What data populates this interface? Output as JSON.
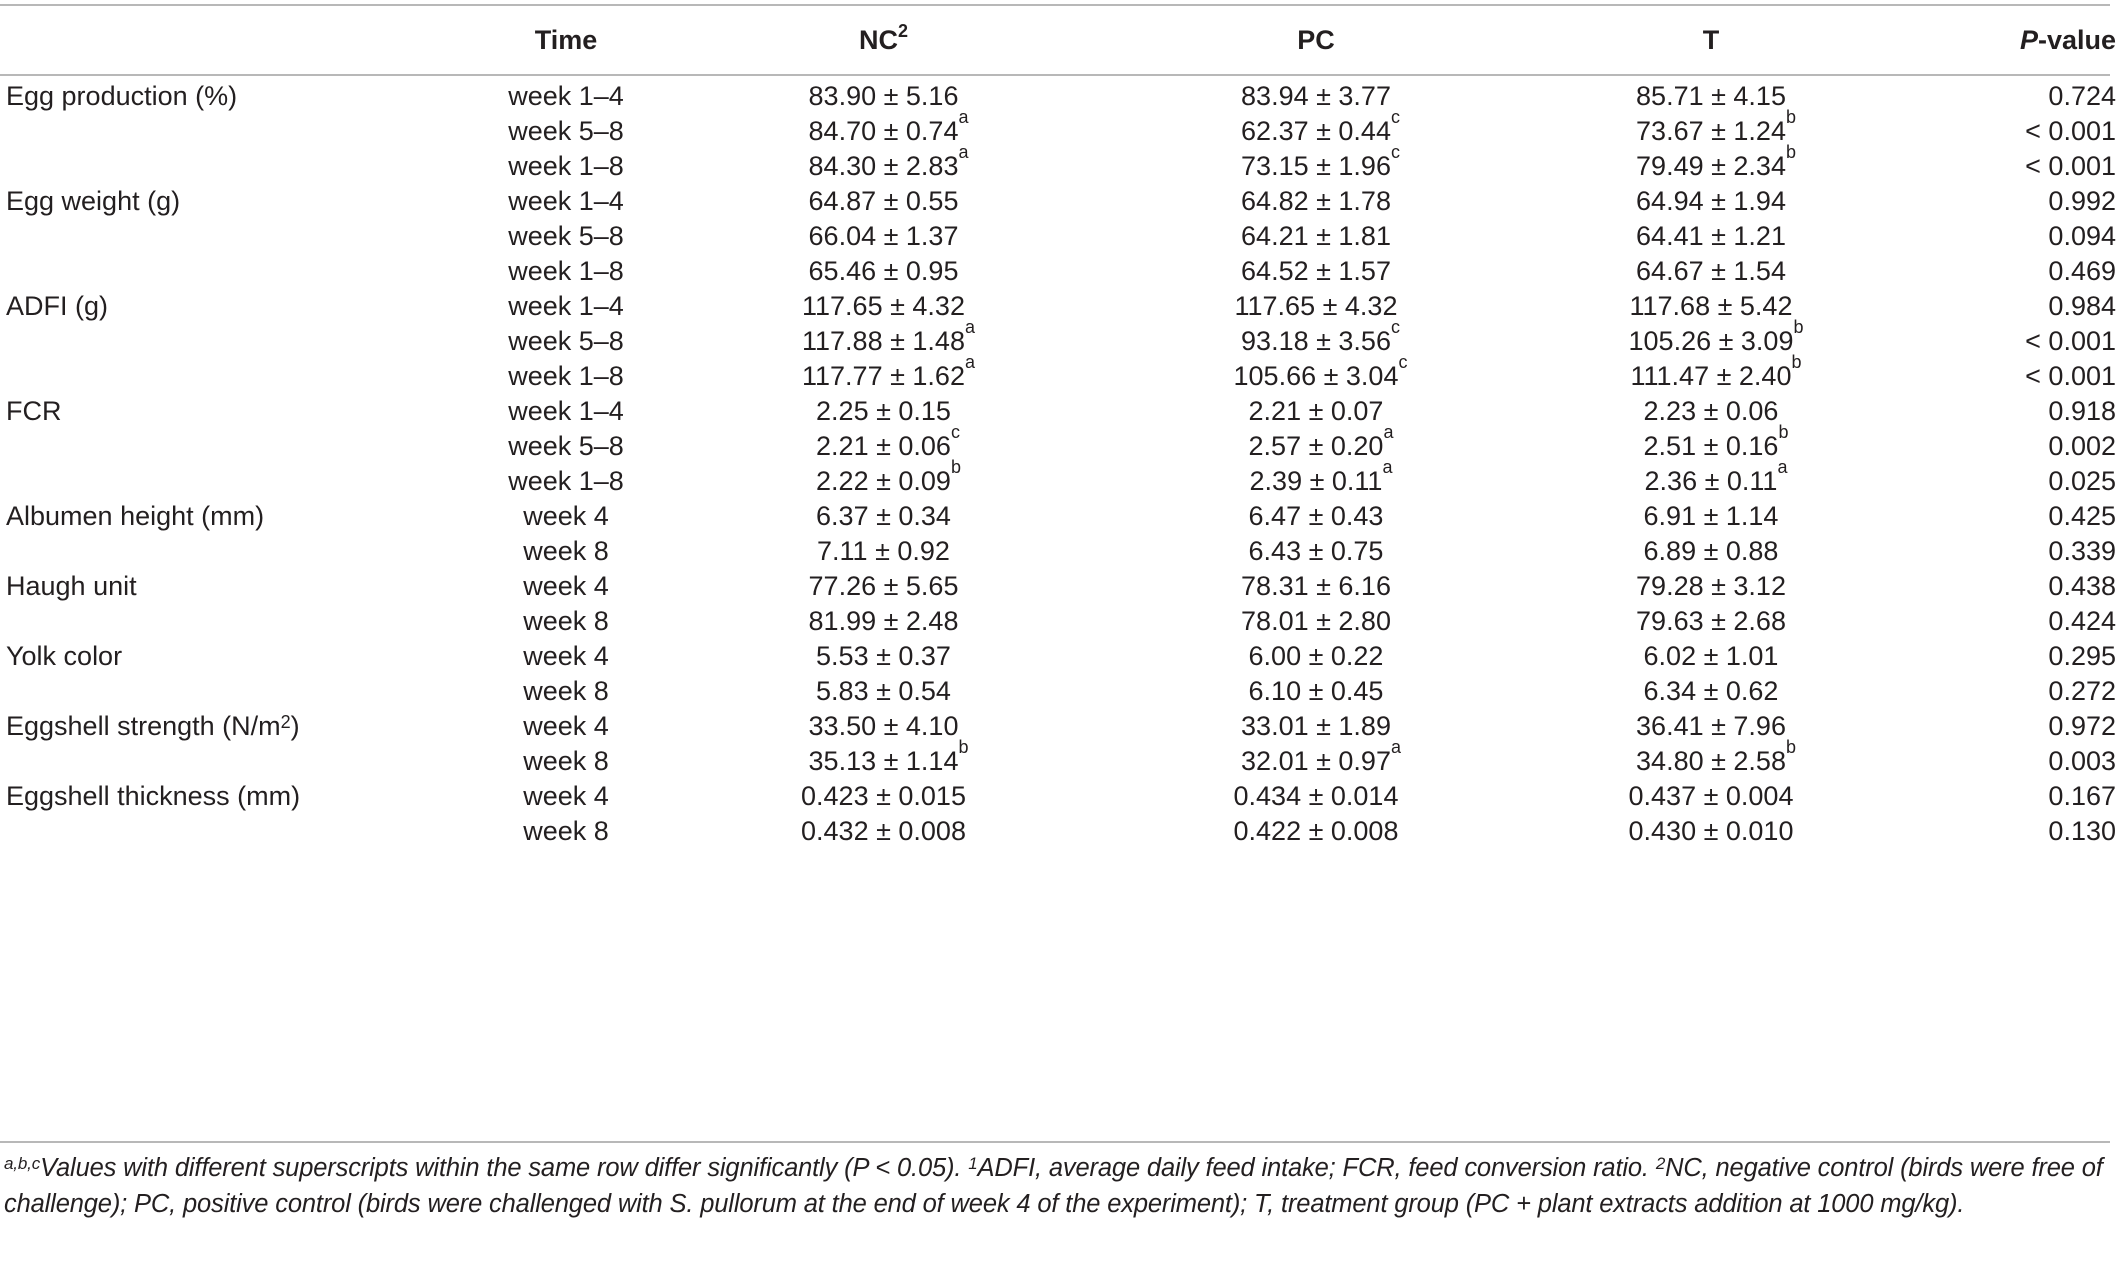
{
  "table": {
    "headers": {
      "parameter": "",
      "time": "Time",
      "nc": "NC",
      "nc_sup": "2",
      "pc": "PC",
      "t": "T",
      "p_italic": "P",
      "p_rest": "-value"
    },
    "rows": [
      {
        "param": "Egg production (%)",
        "param_sup": "",
        "param_tail": "",
        "time": "week 1–4",
        "nc": "83.90 ± 5.16",
        "nc_sup": "",
        "pc": "83.94 ± 3.77",
        "pc_sup": "",
        "t": "85.71 ± 4.15",
        "t_sup": "",
        "p": "0.724"
      },
      {
        "param": "",
        "param_sup": "",
        "param_tail": "",
        "time": "week 5–8",
        "nc": "84.70 ± 0.74",
        "nc_sup": "a",
        "pc": "62.37 ± 0.44",
        "pc_sup": "c",
        "t": "73.67 ± 1.24",
        "t_sup": "b",
        "p": "< 0.001"
      },
      {
        "param": "",
        "param_sup": "",
        "param_tail": "",
        "time": "week 1–8",
        "nc": "84.30 ± 2.83",
        "nc_sup": "a",
        "pc": "73.15 ± 1.96",
        "pc_sup": "c",
        "t": "79.49 ± 2.34",
        "t_sup": "b",
        "p": "< 0.001"
      },
      {
        "param": "Egg weight (g)",
        "param_sup": "",
        "param_tail": "",
        "time": "week 1–4",
        "nc": "64.87 ± 0.55",
        "nc_sup": "",
        "pc": "64.82 ± 1.78",
        "pc_sup": "",
        "t": "64.94 ± 1.94",
        "t_sup": "",
        "p": "0.992"
      },
      {
        "param": "",
        "param_sup": "",
        "param_tail": "",
        "time": "week 5–8",
        "nc": "66.04 ± 1.37",
        "nc_sup": "",
        "pc": "64.21 ± 1.81",
        "pc_sup": "",
        "t": "64.41 ± 1.21",
        "t_sup": "",
        "p": "0.094"
      },
      {
        "param": "",
        "param_sup": "",
        "param_tail": "",
        "time": "week 1–8",
        "nc": "65.46 ± 0.95",
        "nc_sup": "",
        "pc": "64.52 ± 1.57",
        "pc_sup": "",
        "t": "64.67 ± 1.54",
        "t_sup": "",
        "p": "0.469"
      },
      {
        "param": "ADFI (g)",
        "param_sup": "",
        "param_tail": "",
        "time": "week 1–4",
        "nc": "117.65 ± 4.32",
        "nc_sup": "",
        "pc": "117.65 ± 4.32",
        "pc_sup": "",
        "t": "117.68 ± 5.42",
        "t_sup": "",
        "p": "0.984"
      },
      {
        "param": "",
        "param_sup": "",
        "param_tail": "",
        "time": "week 5–8",
        "nc": "117.88 ± 1.48",
        "nc_sup": "a",
        "pc": "93.18 ± 3.56",
        "pc_sup": "c",
        "t": "105.26 ± 3.09",
        "t_sup": "b",
        "p": "< 0.001"
      },
      {
        "param": "",
        "param_sup": "",
        "param_tail": "",
        "time": "week 1–8",
        "nc": "117.77 ± 1.62",
        "nc_sup": "a",
        "pc": "105.66 ± 3.04",
        "pc_sup": "c",
        "t": "111.47 ± 2.40",
        "t_sup": "b",
        "p": "< 0.001"
      },
      {
        "param": "FCR",
        "param_sup": "",
        "param_tail": "",
        "time": "week 1–4",
        "nc": "2.25 ± 0.15",
        "nc_sup": "",
        "pc": "2.21 ± 0.07",
        "pc_sup": "",
        "t": "2.23 ± 0.06",
        "t_sup": "",
        "p": "0.918"
      },
      {
        "param": "",
        "param_sup": "",
        "param_tail": "",
        "time": "week 5–8",
        "nc": "2.21 ± 0.06",
        "nc_sup": "c",
        "pc": "2.57 ± 0.20",
        "pc_sup": "a",
        "t": "2.51 ± 0.16",
        "t_sup": "b",
        "p": "0.002"
      },
      {
        "param": "",
        "param_sup": "",
        "param_tail": "",
        "time": "week 1–8",
        "nc": "2.22 ± 0.09",
        "nc_sup": "b",
        "pc": "2.39 ± 0.11",
        "pc_sup": "a",
        "t": "2.36 ± 0.11",
        "t_sup": "a",
        "p": "0.025"
      },
      {
        "param": "Albumen height (mm)",
        "param_sup": "",
        "param_tail": "",
        "time": "week 4",
        "nc": "6.37 ± 0.34",
        "nc_sup": "",
        "pc": "6.47 ± 0.43",
        "pc_sup": "",
        "t": "6.91 ± 1.14",
        "t_sup": "",
        "p": "0.425"
      },
      {
        "param": "",
        "param_sup": "",
        "param_tail": "",
        "time": "week 8",
        "nc": "7.11 ± 0.92",
        "nc_sup": "",
        "pc": "6.43 ± 0.75",
        "pc_sup": "",
        "t": "6.89 ± 0.88",
        "t_sup": "",
        "p": "0.339"
      },
      {
        "param": "Haugh unit",
        "param_sup": "",
        "param_tail": "",
        "time": "week 4",
        "nc": "77.26 ± 5.65",
        "nc_sup": "",
        "pc": "78.31 ± 6.16",
        "pc_sup": "",
        "t": "79.28 ± 3.12",
        "t_sup": "",
        "p": "0.438"
      },
      {
        "param": "",
        "param_sup": "",
        "param_tail": "",
        "time": "week 8",
        "nc": "81.99 ± 2.48",
        "nc_sup": "",
        "pc": "78.01 ± 2.80",
        "pc_sup": "",
        "t": "79.63 ± 2.68",
        "t_sup": "",
        "p": "0.424"
      },
      {
        "param": "Yolk color",
        "param_sup": "",
        "param_tail": "",
        "time": "week 4",
        "nc": "5.53 ± 0.37",
        "nc_sup": "",
        "pc": "6.00 ± 0.22",
        "pc_sup": "",
        "t": "6.02 ± 1.01",
        "t_sup": "",
        "p": "0.295"
      },
      {
        "param": "",
        "param_sup": "",
        "param_tail": "",
        "time": "week 8",
        "nc": "5.83 ± 0.54",
        "nc_sup": "",
        "pc": "6.10 ± 0.45",
        "pc_sup": "",
        "t": "6.34 ± 0.62",
        "t_sup": "",
        "p": "0.272"
      },
      {
        "param": "Eggshell strength (N/m",
        "param_sup": "2",
        "param_tail": ")",
        "time": "week 4",
        "nc": "33.50 ± 4.10",
        "nc_sup": "",
        "pc": "33.01 ± 1.89",
        "pc_sup": "",
        "t": "36.41 ± 7.96",
        "t_sup": "",
        "p": "0.972"
      },
      {
        "param": "",
        "param_sup": "",
        "param_tail": "",
        "time": "week 8",
        "nc": "35.13 ± 1.14",
        "nc_sup": "b",
        "pc": "32.01 ± 0.97",
        "pc_sup": "a",
        "t": "34.80 ± 2.58",
        "t_sup": "b",
        "p": "0.003"
      },
      {
        "param": "Eggshell thickness (mm)",
        "param_sup": "",
        "param_tail": "",
        "time": "week 4",
        "nc": "0.423 ± 0.015",
        "nc_sup": "",
        "pc": "0.434 ± 0.014",
        "pc_sup": "",
        "t": "0.437 ± 0.004",
        "t_sup": "",
        "p": "0.167"
      },
      {
        "param": "",
        "param_sup": "",
        "param_tail": "",
        "time": "week 8",
        "nc": "0.432 ± 0.008",
        "nc_sup": "",
        "pc": "0.422 ± 0.008",
        "pc_sup": "",
        "t": "0.430 ± 0.010",
        "t_sup": "",
        "p": "0.130"
      }
    ]
  },
  "footnote": {
    "sup_abc": "a,b,c",
    "text_1": "Values with different superscripts within the same row differ significantly (P < 0.05). ",
    "sup_1": "1",
    "text_2": "ADFI, average daily feed intake; FCR, feed conversion ratio. ",
    "sup_2": "2",
    "text_3": "NC, negative control (birds were free of challenge); PC, positive control (birds were challenged with S. pullorum at the end of week 4 of the experiment); T, treatment group (PC + plant extracts addition at 1000 mg/kg)."
  }
}
